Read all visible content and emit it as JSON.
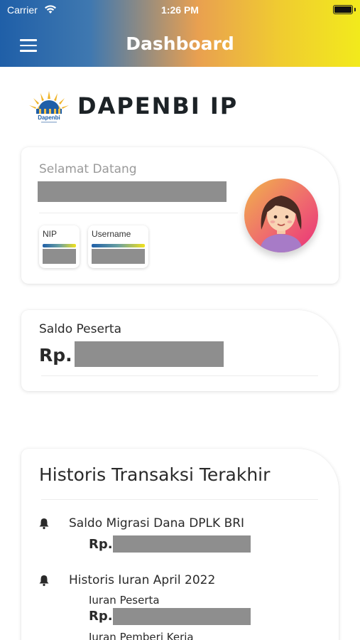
{
  "status_bar": {
    "carrier": "Carrier",
    "time": "1:26 PM"
  },
  "header": {
    "title": "Dashboard",
    "menu_icon": "hamburger-menu-icon"
  },
  "brand": {
    "name": "DAPENBI IP",
    "logo_text": "Dapenbi"
  },
  "welcome_card": {
    "greeting": "Selamat Datang",
    "nip_label": "NIP",
    "username_label": "Username",
    "avatar_icon": "user-avatar-icon"
  },
  "saldo_card": {
    "label": "Saldo Peserta",
    "currency": "Rp."
  },
  "history_card": {
    "title": "Historis Transaksi Terakhir",
    "items": [
      {
        "title": "Saldo Migrasi Dana DPLK BRI",
        "currency": "Rp."
      },
      {
        "title": "Historis Iuran April 2022",
        "sub_label": "Iuran Peserta",
        "currency": "Rp.",
        "sub_label_2": "Iuran Pemberi Kerja"
      }
    ]
  },
  "colors": {
    "gradient_start": "#1f5fa8",
    "gradient_mid": "#e9a050",
    "gradient_end": "#f2ea1c",
    "redaction": "#8e8e8e"
  }
}
